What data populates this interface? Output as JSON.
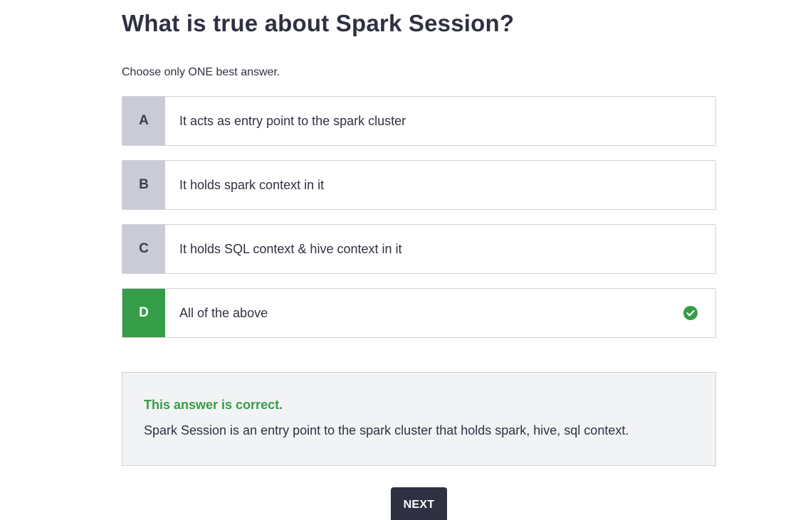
{
  "question": {
    "title": "What is true about Spark Session?",
    "instruction": "Choose only ONE best answer."
  },
  "options": [
    {
      "letter": "A",
      "text": "It acts as entry point to the spark cluster",
      "state": "unselected"
    },
    {
      "letter": "B",
      "text": "It holds spark context in it",
      "state": "unselected"
    },
    {
      "letter": "C",
      "text": "It holds SQL context & hive context in it",
      "state": "unselected"
    },
    {
      "letter": "D",
      "text": "All of the above",
      "state": "correct",
      "icon": "check-circle-icon"
    }
  ],
  "feedback": {
    "status": "This answer is correct.",
    "explanation": "Spark Session is an entry point to the spark cluster that holds spark, hive, sql context."
  },
  "actions": {
    "next_label": "NEXT"
  },
  "colors": {
    "correct": "#359d48",
    "letter_bg": "#c9ccd6",
    "button_bg": "#2f3142",
    "feedback_bg": "#f2f3f5"
  }
}
